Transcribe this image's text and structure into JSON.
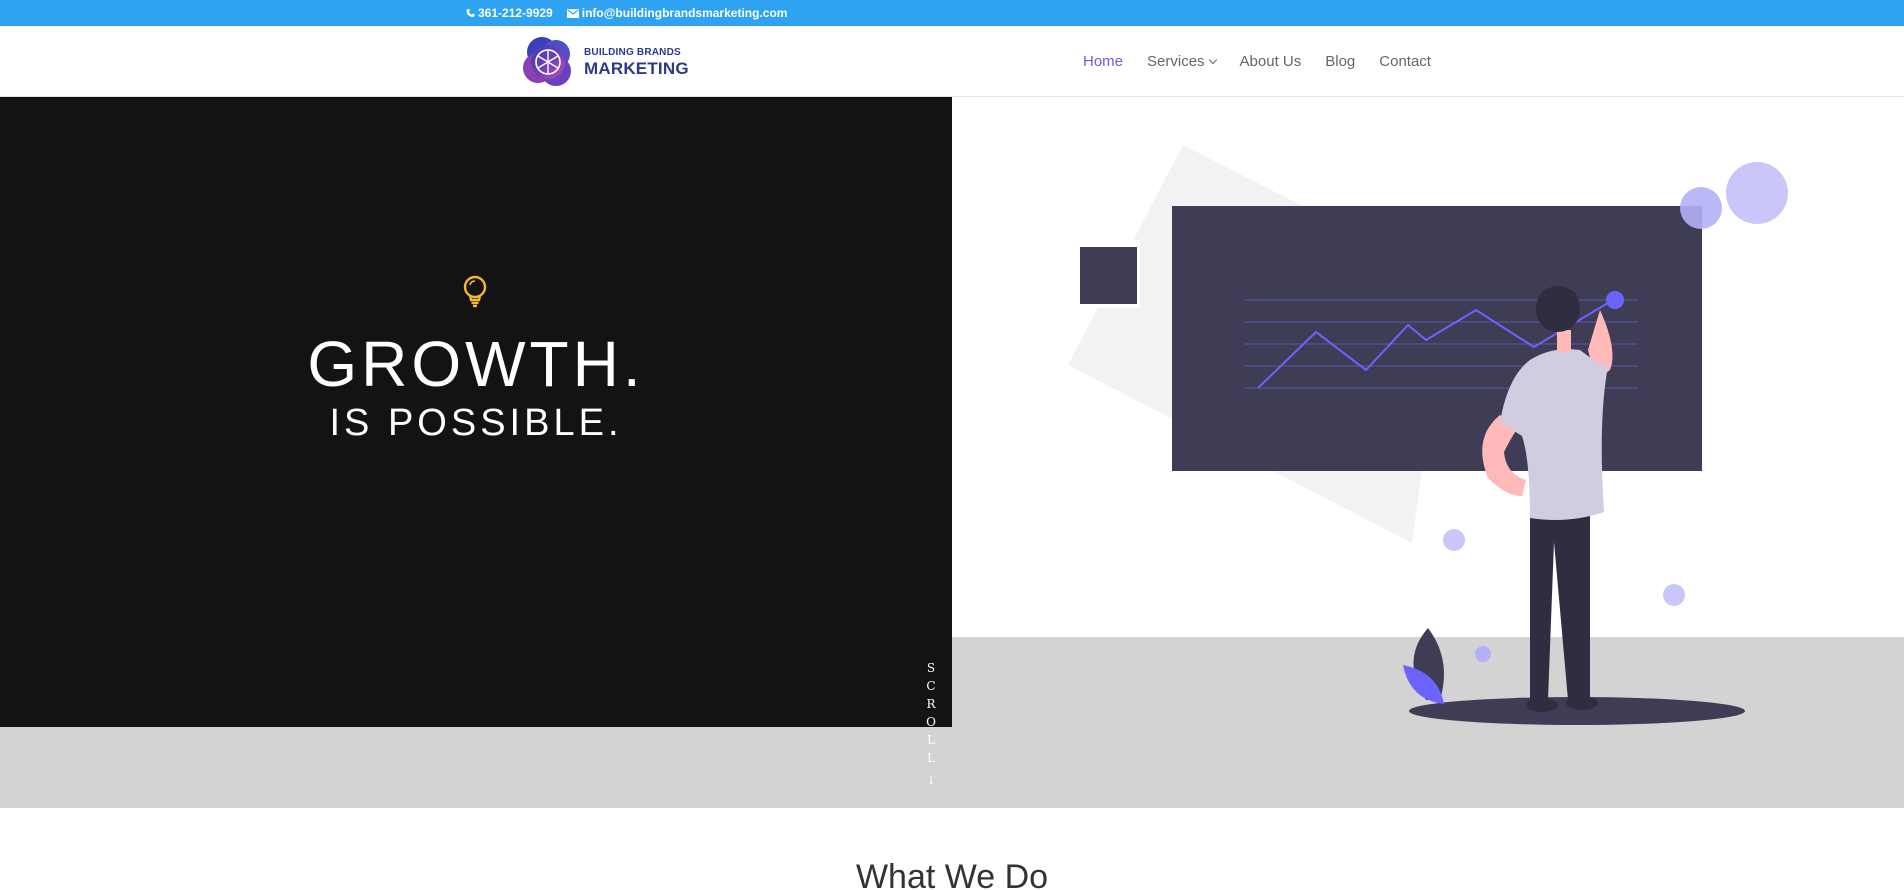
{
  "topbar": {
    "phone": "361-212-9929",
    "email": "info@buildingbrandsmarketing.com",
    "bg_color": "#2ea3f2"
  },
  "header": {
    "logo_line1": "BUILDING BRANDS",
    "logo_line2": "MARKETING",
    "nav": [
      {
        "label": "Home",
        "active": true
      },
      {
        "label": "Services",
        "has_dropdown": true
      },
      {
        "label": "About Us"
      },
      {
        "label": "Blog"
      },
      {
        "label": "Contact"
      }
    ],
    "accent_color": "#6c5ce7"
  },
  "hero": {
    "icon": "lightbulb-icon",
    "headline": "GROWTH.",
    "subheadline": "IS POSSIBLE.",
    "scroll_label": "SCROLL",
    "scroll_arrow": "→",
    "bulb_color": "#f5b82e"
  },
  "section": {
    "title": "What We Do"
  }
}
